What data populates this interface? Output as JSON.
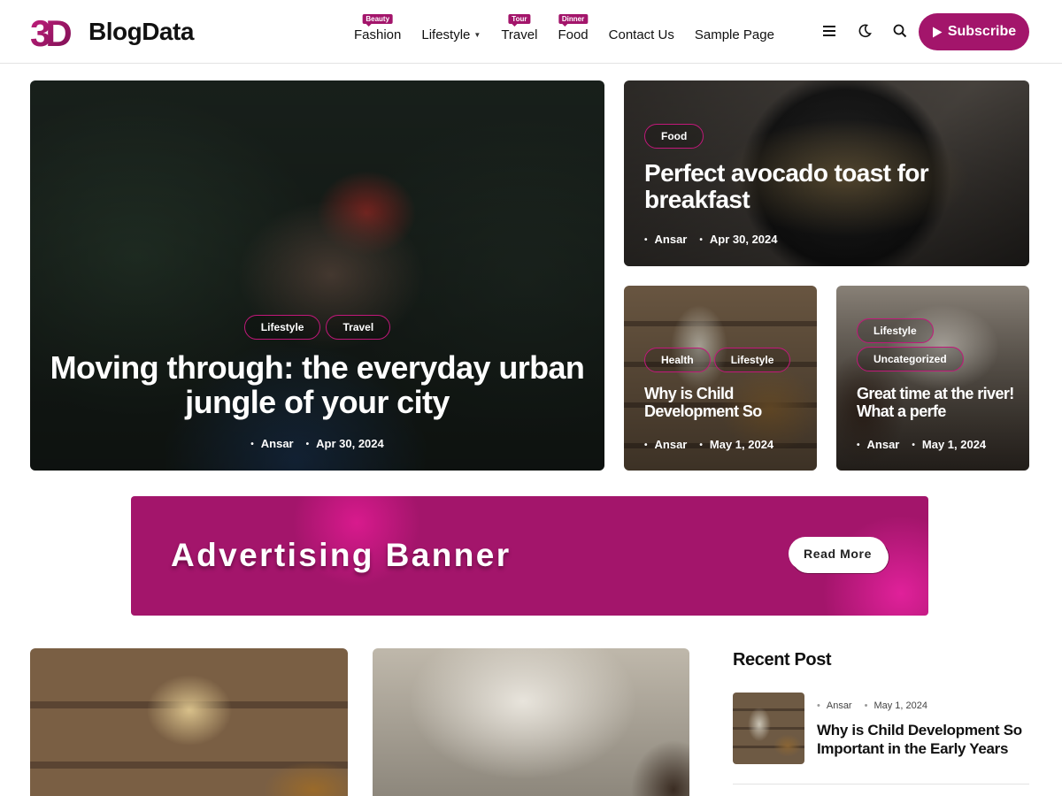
{
  "brand": {
    "logo_mark": "3D",
    "name": "BlogData",
    "accent": "#a3156b"
  },
  "nav": {
    "items": [
      {
        "label": "Fashion",
        "tag": "Beauty"
      },
      {
        "label": "Lifestyle",
        "tag": ""
      },
      {
        "label": "Travel",
        "tag": "Tour"
      },
      {
        "label": "Food",
        "tag": "Dinner"
      },
      {
        "label": "Contact Us",
        "tag": ""
      },
      {
        "label": "Sample Page",
        "tag": ""
      }
    ]
  },
  "header_icons": [
    "menu-icon",
    "moon-icon",
    "search-icon"
  ],
  "subscribe": {
    "label": "Subscribe",
    "icon": "play-icon"
  },
  "featured": {
    "hero": {
      "categories": [
        "Lifestyle",
        "Travel"
      ],
      "title": "Moving through: the everyday urban jungle of your city",
      "author": "Ansar",
      "date": "Apr 30, 2024"
    },
    "top_right": {
      "categories": [
        "Food"
      ],
      "title": "Perfect avocado toast for breakfast",
      "author": "Ansar",
      "date": "Apr 30, 2024"
    },
    "bottom_left": {
      "categories": [
        "Health",
        "Lifestyle"
      ],
      "title": "Why is Child Development So",
      "author": "Ansar",
      "date": "May 1, 2024"
    },
    "bottom_right": {
      "categories": [
        "Lifestyle",
        "Uncategorized"
      ],
      "title": "Great time at the river! What a perfe",
      "author": "Ansar",
      "date": "May 1, 2024"
    }
  },
  "banner": {
    "title": "Advertising Banner",
    "button_label": "Read More"
  },
  "recent": {
    "heading": "Recent Post",
    "items": [
      {
        "author": "Ansar",
        "date": "May 1, 2024",
        "title": "Why is Child Development So Important in the Early Years"
      }
    ]
  }
}
